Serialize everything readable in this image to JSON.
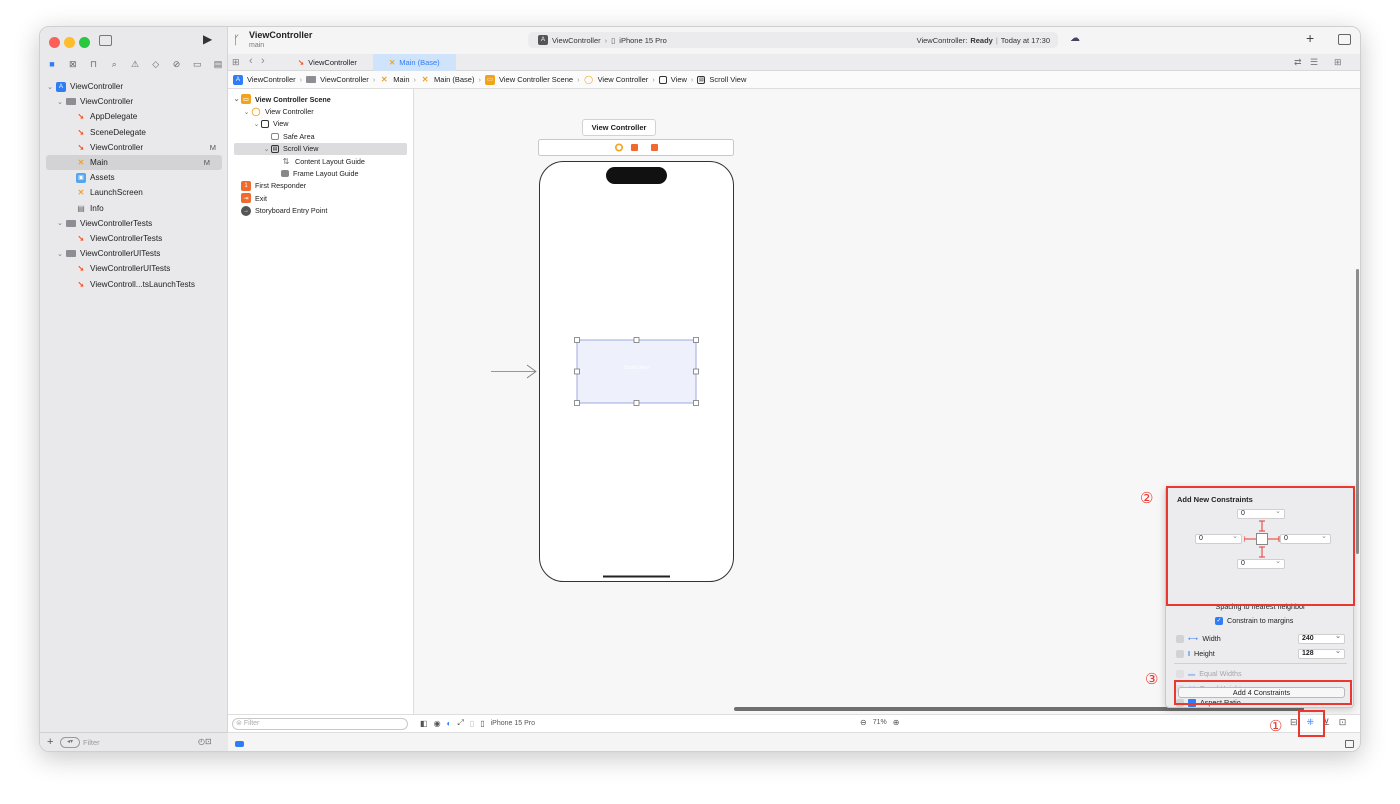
{
  "titlebar": {
    "project": "ViewController",
    "branch": "main",
    "scheme": "ViewController",
    "device": "iPhone 15 Pro",
    "status_prefix": "ViewController:",
    "status_state": "Ready",
    "status_time": "Today at 17:30"
  },
  "navigator": {
    "items": [
      {
        "label": "ViewController",
        "indent": 0,
        "kind": "project",
        "chev": "⌄"
      },
      {
        "label": "ViewController",
        "indent": 1,
        "kind": "folder",
        "chev": "⌄"
      },
      {
        "label": "AppDelegate",
        "indent": 2,
        "kind": "swift"
      },
      {
        "label": "SceneDelegate",
        "indent": 2,
        "kind": "swift"
      },
      {
        "label": "ViewController",
        "indent": 2,
        "kind": "swift",
        "badge": "M"
      },
      {
        "label": "Main",
        "indent": 2,
        "kind": "storyboard",
        "badge": "M",
        "selected": true
      },
      {
        "label": "Assets",
        "indent": 2,
        "kind": "assets"
      },
      {
        "label": "LaunchScreen",
        "indent": 2,
        "kind": "storyboard"
      },
      {
        "label": "Info",
        "indent": 2,
        "kind": "plist"
      },
      {
        "label": "ViewControllerTests",
        "indent": 1,
        "kind": "folder",
        "chev": "⌄"
      },
      {
        "label": "ViewControllerTests",
        "indent": 2,
        "kind": "swift"
      },
      {
        "label": "ViewControllerUITests",
        "indent": 1,
        "kind": "folder",
        "chev": "⌄"
      },
      {
        "label": "ViewControllerUITests",
        "indent": 2,
        "kind": "swift"
      },
      {
        "label": "ViewControll...tsLaunchTests",
        "indent": 2,
        "kind": "swift"
      }
    ],
    "filter_placeholder": "Filter"
  },
  "tabs": [
    {
      "label": "ViewController",
      "active": false
    },
    {
      "label": "Main (Base)",
      "active": true
    }
  ],
  "breadcrumb": [
    "ViewController",
    "ViewController",
    "Main",
    "Main (Base)",
    "View Controller Scene",
    "View Controller",
    "View",
    "Scroll View"
  ],
  "outline": {
    "items": [
      {
        "label": "View Controller Scene",
        "indent": 0,
        "chev": "⌄",
        "bold": true
      },
      {
        "label": "View Controller",
        "indent": 1,
        "chev": "⌄"
      },
      {
        "label": "View",
        "indent": 2,
        "chev": "⌄"
      },
      {
        "label": "Safe Area",
        "indent": 3
      },
      {
        "label": "Scroll View",
        "indent": 3,
        "chev": "⌄",
        "selected": true
      },
      {
        "label": "Content Layout Guide",
        "indent": 4
      },
      {
        "label": "Frame Layout Guide",
        "indent": 4
      },
      {
        "label": "First Responder",
        "indent": 0
      },
      {
        "label": "Exit",
        "indent": 0
      },
      {
        "label": "Storyboard Entry Point",
        "indent": 0
      }
    ],
    "filter_placeholder": "Filter"
  },
  "canvas": {
    "scene_title": "View Controller",
    "scroll_label": "Scroll View"
  },
  "bottombar": {
    "device": "iPhone 15 Pro",
    "zoom": "71%"
  },
  "popover": {
    "title": "Add New Constraints",
    "top": "0",
    "left": "0",
    "right": "0",
    "bottom": "0",
    "spacing_label": "Spacing to nearest neighbor",
    "margins_label": "Constrain to margins",
    "width_label": "Width",
    "width_value": "240",
    "height_label": "Height",
    "height_value": "128",
    "equal_widths": "Equal Widths",
    "equal_heights": "Equal Heights",
    "aspect_ratio": "Aspect Ratio",
    "add_button": "Add 4 Constraints"
  },
  "annotations": {
    "one": "①",
    "two": "②",
    "three": "③"
  },
  "colors": {
    "accent": "#2f7df6",
    "annotation": "#e8382f",
    "swift": "#f0552c"
  }
}
